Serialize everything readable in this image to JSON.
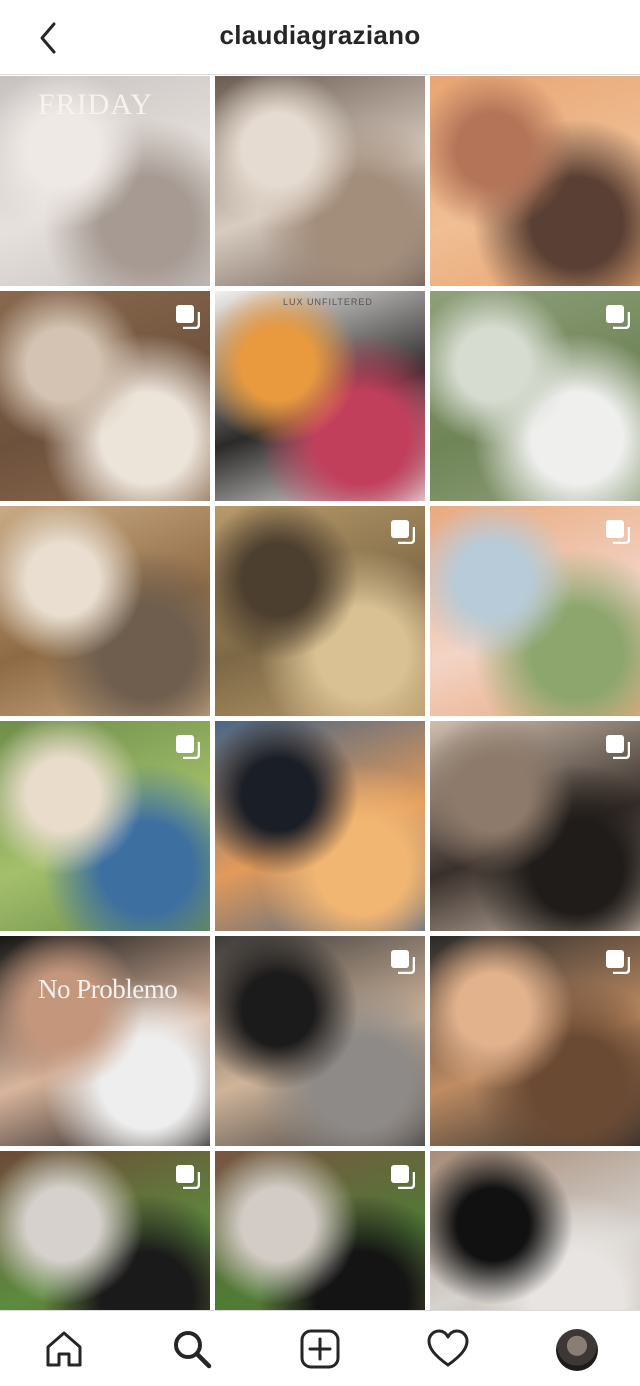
{
  "header": {
    "username": "claudiagraziano",
    "back_icon": "chevron-left-icon"
  },
  "grid": {
    "tiles": [
      {
        "row": 0,
        "col": 0,
        "label": "friday-living-room-post",
        "overlay_text": "FRIDAY",
        "multi": false,
        "colors": [
          "#c7c2c0",
          "#e7e1dd",
          "#efe9e6",
          "#a69a92"
        ]
      },
      {
        "row": 0,
        "col": 1,
        "label": "stairs-coffee-outfit-post",
        "multi": false,
        "colors": [
          "#6b5c52",
          "#d8cbbf",
          "#e6dbd0",
          "#a38d7b"
        ]
      },
      {
        "row": 0,
        "col": 2,
        "label": "sunset-mountains-city-post",
        "multi": false,
        "colors": [
          "#e8a572",
          "#f0be94",
          "#b37458",
          "#5a4034"
        ]
      },
      {
        "row": 1,
        "col": 0,
        "label": "wood-fence-white-top-post",
        "multi": true,
        "colors": [
          "#8a6a4e",
          "#6e513c",
          "#d4c3b2",
          "#ece3d9"
        ]
      },
      {
        "row": 1,
        "col": 1,
        "label": "product-citrus-drinks-post",
        "overlay_text": "LUX UNFILTERED",
        "multi": false,
        "colors": [
          "#f3f1ef",
          "#2b2a29",
          "#e99a3e",
          "#c23f5c"
        ]
      },
      {
        "row": 1,
        "col": 2,
        "label": "white-set-plants-post",
        "multi": true,
        "colors": [
          "#8fa07a",
          "#6f8457",
          "#d7dcd1",
          "#efefee"
        ]
      },
      {
        "row": 2,
        "col": 0,
        "label": "cafe-interior-post",
        "multi": false,
        "colors": [
          "#c9ab85",
          "#8e6a44",
          "#e9ded0",
          "#6f5e4e"
        ]
      },
      {
        "row": 2,
        "col": 1,
        "label": "golden-field-cap-post",
        "multi": true,
        "colors": [
          "#b89a6a",
          "#7d6846",
          "#4d3f2f",
          "#d9c193"
        ]
      },
      {
        "row": 2,
        "col": 2,
        "label": "flowers-tea-table-post",
        "multi": true,
        "colors": [
          "#e9a97d",
          "#f3d4c6",
          "#b7cbd8",
          "#8da66e"
        ]
      },
      {
        "row": 3,
        "col": 0,
        "label": "garden-party-blue-dress-post",
        "multi": true,
        "colors": [
          "#6e8e4a",
          "#a4c06c",
          "#e9dccb",
          "#3d6fa0"
        ]
      },
      {
        "row": 3,
        "col": 1,
        "label": "sunset-coastline-post",
        "multi": false,
        "colors": [
          "#4a6684",
          "#e39a5a",
          "#1a1e26",
          "#f2b673"
        ]
      },
      {
        "row": 3,
        "col": 2,
        "label": "restaurant-evening-post",
        "multi": true,
        "colors": [
          "#cfbfae",
          "#3a302b",
          "#8e7a6a",
          "#201c1a"
        ]
      },
      {
        "row": 4,
        "col": 0,
        "label": "no-problemo-tee-post",
        "overlay_text": "No Problemo",
        "multi": false,
        "colors": [
          "#161616",
          "#d9b59d",
          "#c4977d",
          "#eeeeee"
        ]
      },
      {
        "row": 4,
        "col": 1,
        "label": "car-interior-black-outfit-post",
        "multi": true,
        "colors": [
          "#3c3a39",
          "#cfb49a",
          "#1c1b1b",
          "#8e8a87"
        ]
      },
      {
        "row": 4,
        "col": 2,
        "label": "steering-wheel-bag-post",
        "multi": true,
        "colors": [
          "#2a2a2a",
          "#bf8c63",
          "#e2b28d",
          "#6b4a33"
        ]
      },
      {
        "row": 5,
        "col": 0,
        "label": "wood-fence-black-dress-post",
        "multi": true,
        "colors": [
          "#6d4a37",
          "#5d8b3f",
          "#d6d1cc",
          "#1a1a1a"
        ]
      },
      {
        "row": 5,
        "col": 1,
        "label": "wood-fence-sunglasses-post",
        "multi": true,
        "colors": [
          "#7a5542",
          "#4f7c36",
          "#d3ccc6",
          "#141414"
        ]
      },
      {
        "row": 5,
        "col": 2,
        "label": "black-bag-sidewalk-post",
        "multi": false,
        "colors": [
          "#a78c78",
          "#d6d2ce",
          "#111111",
          "#e7e4e1"
        ]
      },
      {
        "row": 6,
        "col": 0,
        "label": "partial-post-1",
        "multi": false,
        "partial": true,
        "colors": [
          "#3a3530",
          "#6a5a4a",
          "#2a2622",
          "#8a7a6a"
        ]
      },
      {
        "row": 6,
        "col": 1,
        "label": "partial-post-2",
        "multi": false,
        "partial": true,
        "colors": [
          "#c2a88c",
          "#e0cfbe",
          "#8c6e56",
          "#d8c4b0"
        ]
      },
      {
        "row": 6,
        "col": 2,
        "label": "partial-post-3",
        "multi": true,
        "partial": true,
        "colors": [
          "#2f78c8",
          "#5a9ee0",
          "#2a5f9e",
          "#7ab2ea"
        ]
      }
    ]
  },
  "tabbar": {
    "items": [
      {
        "name": "home-icon"
      },
      {
        "name": "search-icon"
      },
      {
        "name": "new-post-icon"
      },
      {
        "name": "activity-heart-icon"
      },
      {
        "name": "profile-avatar"
      }
    ]
  },
  "theme": {
    "text": "#262626",
    "border": "#dbdbdb",
    "background": "#ffffff"
  }
}
